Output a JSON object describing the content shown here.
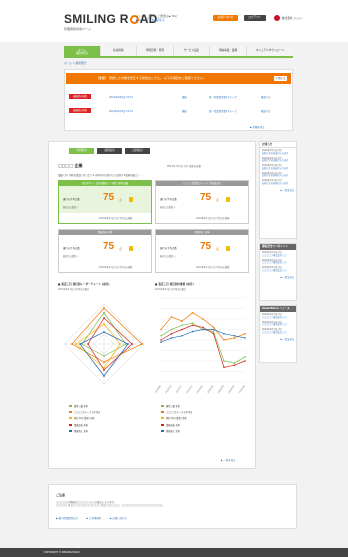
{
  "header": {
    "logo_text_1": "SMILING R",
    "logo_text_2": "AD",
    "tagline": "管理者様専用ページ",
    "notice_line": "よくある ご質問・ご要望は ▶ FAQ",
    "notice_link": "▶ マニュアルを確認する",
    "orange_btn": "お問い合わせ",
    "dark_btn": "ログアウト",
    "brand_name": "株式会社 ○○○○"
  },
  "nav": {
    "items": [
      "ホーム\n(個別状況)",
      "社員情報",
      "年間目標・管理",
      "サービス設定",
      "特殊事業・業務",
      "マニュアルダウンロード"
    ]
  },
  "breadcrumb": "ホーム > 個別状況",
  "alert": {
    "banner": "【重要】 登録した内容を修正する場合はこちら。 以下の項目をご確認ください。",
    "close": "× 閉じる",
    "rows": [
      {
        "tag": "未確認の項目",
        "date": "2014年6月6日 10:31",
        "type": "運転",
        "group": "第一営業部営業1グループ",
        "action": "確認する"
      },
      {
        "tag": "未確認の項目",
        "date": "2014年6月6日 10:31",
        "type": "運転",
        "group": "第一営業部営業1グループ",
        "action": "確認する"
      }
    ],
    "more": "▶ 詳細を見る"
  },
  "main": {
    "tabs": [
      "月別表示",
      "週別表示",
      "日別表示"
    ],
    "company": "□□□□ 企業",
    "updated": "2014年7月1日 (月) 更新の結果",
    "meta": "業績 (月) 月額    従業員 (月) 合計    ※ 前年同月の数字との比較 (※業務実績上) ...",
    "cards": [
      {
        "head": "全社平均 ＋ 会社規模別 ＋ 年間 / 通年実績",
        "label": "運行の平均点数",
        "score": "75",
        "unit": "点",
        "sub": "前回との変化 ＋",
        "foot": "2014年6月1日 (日)  平均点の推移"
      },
      {
        "head": "□□□□営業部グループ 北海道支社",
        "label": "運行の平均点数",
        "score": "75",
        "unit": "点",
        "sub": "前回との変化 ＋",
        "foot": "2014年6月1日 (日)  平均点の推移"
      },
      {
        "head": "業務改善 全体",
        "label": "運行の平均点数",
        "score": "75",
        "unit": "点",
        "sub": "前回との変化 ＋",
        "foot": "2014年6月1日 (日)  平均点の推移"
      },
      {
        "head": "事故防止 全体",
        "label": "運行の平均点数",
        "score": "75",
        "unit": "点",
        "sub": "前回との変化 ＋",
        "foot": "2014年6月1日 (日)  平均点の推移"
      }
    ],
    "radar": {
      "title": "■ 直近三月 項目別レーダーチャート (前月)",
      "sub": "2014年6月1日 (月) 時点の集計"
    },
    "line": {
      "title": "■ 直近三月 項目別の推移 (前月)",
      "sub": "2014年6月1日 (月) 時点の集計"
    },
    "legend": [
      {
        "name": "運用三課 全体",
        "color": "#7cc04a"
      },
      {
        "name": "□□□□グループ の平均点",
        "color": "#f07800"
      },
      {
        "name": "他社平均 (業界) 全体",
        "color": "#f5b800"
      },
      {
        "name": "業務改善 全体",
        "color": "#d22222"
      },
      {
        "name": "事故防止 全体",
        "color": "#2a6ebb"
      }
    ],
    "radar_values": {
      "green": [
        0.78,
        0.55,
        0.3,
        0.55
      ],
      "orange": [
        0.9,
        0.95,
        0.45,
        0.8
      ],
      "yellow": [
        0.5,
        0.4,
        0.6,
        0.7
      ],
      "red": [
        0.65,
        0.7,
        0.65,
        0.4
      ],
      "blue": [
        0.3,
        0.6,
        0.8,
        0.6
      ]
    },
    "line_values": {
      "orange": [
        70,
        82,
        78,
        86,
        80,
        72,
        60,
        62,
        66
      ],
      "green": [
        64,
        70,
        74,
        76,
        70,
        68,
        40,
        38,
        44
      ],
      "red": [
        60,
        66,
        70,
        74,
        72,
        66,
        34,
        36,
        40
      ],
      "blue": [
        58,
        62,
        64,
        68,
        70,
        70,
        66,
        64,
        62
      ]
    },
    "line_xlabels": [
      "2013/09",
      "2013/10",
      "2013/11",
      "2013/12",
      "2014/01",
      "2014/02",
      "2014/03",
      "2014/04",
      "2014/05"
    ],
    "more": "▶ 一覧を見る"
  },
  "sidebar": {
    "news_title": "お知らせ",
    "news": [
      {
        "date": "2014年7月1日 (月)",
        "text": "お知らせの内容が入ります"
      },
      {
        "date": "2014年7月1日 (月)",
        "text": "お知らせの内容が入ります"
      },
      {
        "date": "2014年7月1日 (月)",
        "text": "お知らせの内容が入ります"
      },
      {
        "date": "2014年7月1日 (月)",
        "text": "お知らせの内容が入ります"
      },
      {
        "date": "2014年7月1日 (月)",
        "text": "お知らせの内容が入ります"
      }
    ],
    "news_more": "▶ 一覧を見る",
    "tips_title": "運転安全ワンポイント",
    "tips": [
      {
        "date": "2014年7月1日 (月)",
        "text": "□□□□□ 株式会社 □□"
      },
      {
        "date": "2014年7月1日 (月)",
        "text": "□□□□□ 株式会社 □□"
      },
      {
        "date": "2014年7月1日 (月)",
        "text": "□□□□□ 株式会社 □□"
      }
    ],
    "tips_more": "▶ 一覧を見る",
    "news2_title": "SmartDrive ニュース",
    "news2": [
      {
        "date": "2014年7月1日 (月)",
        "text": "□□□□□ 株式会社 □□"
      },
      {
        "date": "2014年7月1日 (月)",
        "text": "□□□□□ 株式会社 □□"
      },
      {
        "date": "2014年7月1日 (月)",
        "text": "□□□□□ 株式会社 □□"
      }
    ],
    "news2_more": "▶ 一覧を見る"
  },
  "footer_notice": {
    "title": "ご注意",
    "text": "□□□□□の情報は□□□□□□□□の集計によります。\n□□□□□ 月の□□□□□□□□□□□□ 月の□□□□□□。□□□□□□□□□□□□□□□□□□。",
    "links": [
      "▶ 個人情報保護方針",
      "▶ ご利用規約",
      "▶ お問い合わせ"
    ]
  },
  "page_footer": "COPYRIGHT © SMILING ROAD"
}
